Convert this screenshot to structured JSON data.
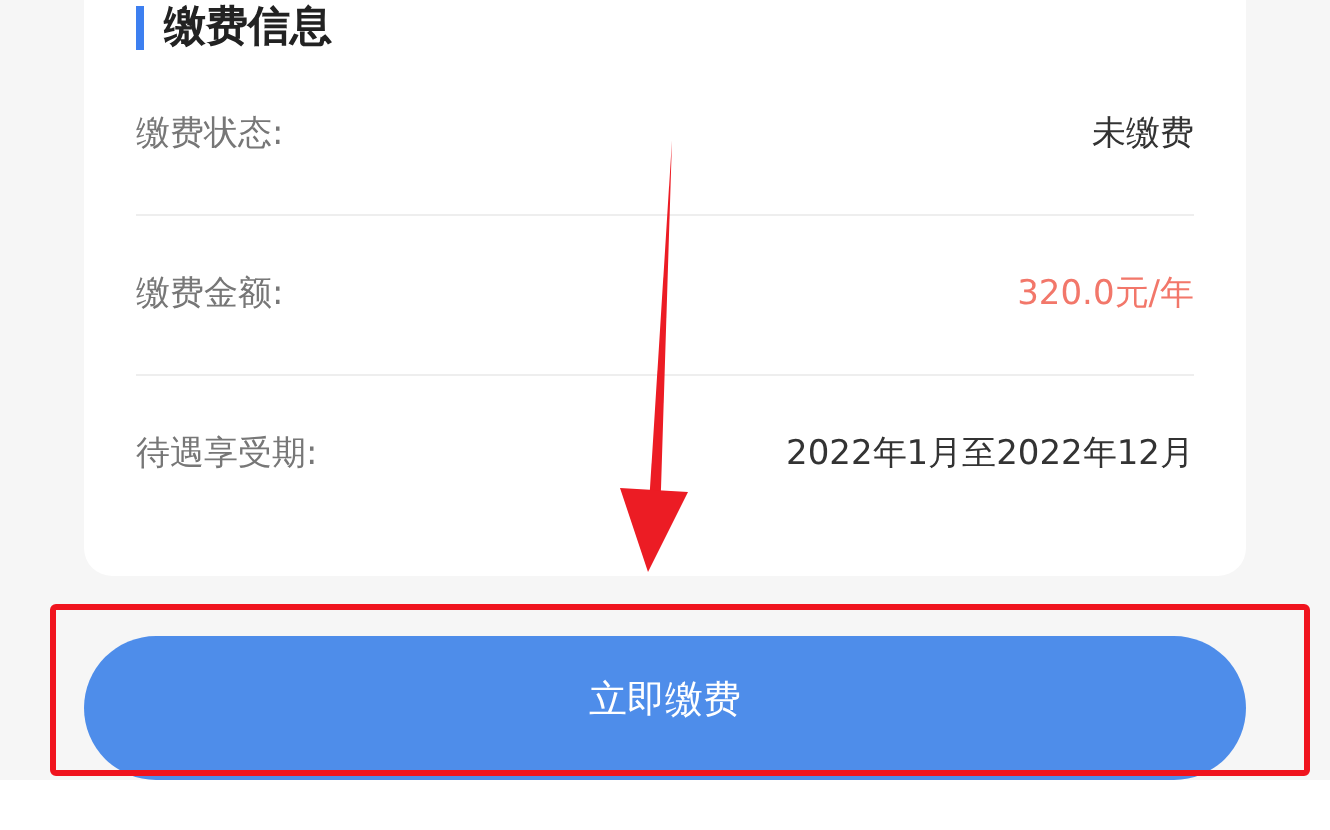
{
  "section": {
    "title": "缴费信息"
  },
  "rows": [
    {
      "label": "缴费状态:",
      "value": "未缴费",
      "kind": "plain"
    },
    {
      "label": "缴费金额:",
      "value": "320.0元/年",
      "kind": "amount"
    },
    {
      "label": "待遇享受期:",
      "value": "2022年1月至2022年12月",
      "kind": "plain"
    }
  ],
  "button": {
    "label": "立即缴费"
  }
}
